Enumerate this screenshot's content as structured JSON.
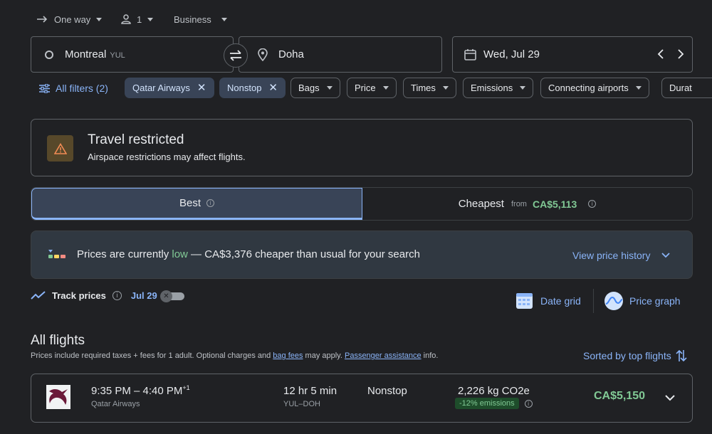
{
  "trip": {
    "type": "One way",
    "passengers": "1",
    "cabin": "Business"
  },
  "search": {
    "origin_city": "Montreal",
    "origin_code": "YUL",
    "destination": "Doha",
    "date": "Wed, Jul 29"
  },
  "filters": {
    "all_filters": "All filters (2)",
    "chips": [
      "Qatar Airways",
      "Nonstop",
      "Bags",
      "Price",
      "Times",
      "Emissions",
      "Connecting airports",
      "Durat"
    ]
  },
  "notice": {
    "title": "Travel restricted",
    "text": "Airspace restrictions may affect flights."
  },
  "tabs": {
    "best": "Best",
    "cheapest": "Cheapest",
    "from": "from",
    "cheapest_price": "CA$5,113"
  },
  "insight": {
    "pre": "Prices are currently ",
    "level": "low",
    "post": " — CA$3,376 cheaper than usual for your search",
    "history": "View price history"
  },
  "track": {
    "label": "Track prices",
    "date": "Jul 29",
    "date_grid": "Date grid",
    "price_graph": "Price graph"
  },
  "results": {
    "heading": "All flights",
    "sub_pre": "Prices include required taxes + fees for 1 adult. Optional charges and ",
    "bag_fees": "bag fees",
    "sub_mid": " may apply. ",
    "assistance": "Passenger assistance",
    "sub_post": " info.",
    "sort": "Sorted by top flights"
  },
  "flight": {
    "times": "9:35 PM – 4:40 PM",
    "day_offset": "+1",
    "airline": "Qatar Airways",
    "duration": "12 hr 5 min",
    "route": "YUL–DOH",
    "stops": "Nonstop",
    "co2": "2,226 kg CO2e",
    "emissions_badge": "-12% emissions",
    "price": "CA$5,150"
  },
  "colors": {
    "accent": "#8ab4f8",
    "price_green": "#81c995",
    "chip_active": "#394457"
  }
}
